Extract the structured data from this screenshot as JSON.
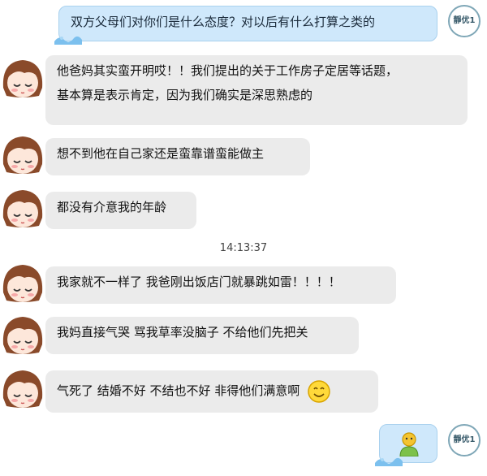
{
  "messages": [
    {
      "side": "out",
      "text": "双方父母们对你们是什么态度？对以后有什么打算之类的"
    },
    {
      "side": "in",
      "lines": [
        "他爸妈其实蛮开明哎！！我们提出的关于工作房子定居等话题，",
        "基本算是表示肯定，因为我们确实是深思熟虑的"
      ]
    },
    {
      "side": "in",
      "text": "想不到他在自己家还是蛮靠谱蛮能做主"
    },
    {
      "side": "in",
      "text": "都没有介意我的年龄"
    },
    {
      "side": "in",
      "text": "我家就不一样了 我爸刚出饭店门就暴跳如雷！！！！"
    },
    {
      "side": "in",
      "text": "我妈直接气哭 骂我草率没脑子 不给他们先把关"
    },
    {
      "side": "in",
      "text": "气死了 结婚不好 不结也不好 非得他们满意啊"
    },
    {
      "side": "out",
      "emoji": "person-icon"
    }
  ],
  "timestamp": "14:13:37",
  "me_avatar_label": "靜优1"
}
